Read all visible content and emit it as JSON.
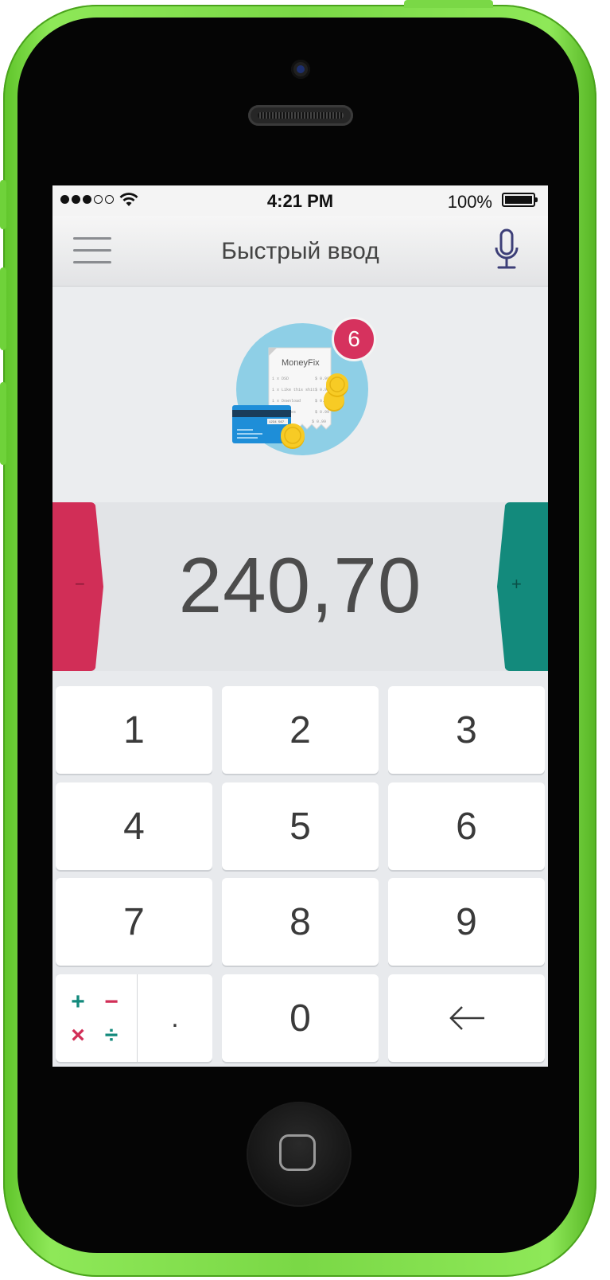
{
  "status_bar": {
    "time": "4:21 PM",
    "battery_percent": "100%",
    "signal_bars_filled": 3,
    "signal_bars_total": 5
  },
  "nav": {
    "title": "Быстрый ввод",
    "left_icon": "hamburger-menu-icon",
    "right_icon": "microphone-icon"
  },
  "illustration": {
    "brand": "MoneyFix",
    "badge_count": "6",
    "receipt_lines": [
      "1 x DSD",
      "1 x Like this shit",
      "1 x Download",
      "1 x ...les"
    ],
    "receipt_prices": [
      "$ 0.99",
      "$ 0.99",
      "$ 0.99",
      "$ 0.99"
    ],
    "receipt_total": "$ 0.99",
    "card_number": "1234 567"
  },
  "amount": {
    "value": "240,70",
    "minus_label": "−",
    "plus_label": "+"
  },
  "keypad": {
    "keys": [
      "1",
      "2",
      "3",
      "4",
      "5",
      "6",
      "7",
      "8",
      "9"
    ],
    "zero": "0",
    "decimal": ".",
    "backspace": "←",
    "operators": {
      "plus": "+",
      "minus": "−",
      "multiply": "×",
      "divide": "÷"
    }
  },
  "colors": {
    "phone_shell": "#7ad846",
    "minus_accent": "#d12e57",
    "plus_accent": "#138a7c",
    "illustration_circle": "#8ecfe6"
  }
}
